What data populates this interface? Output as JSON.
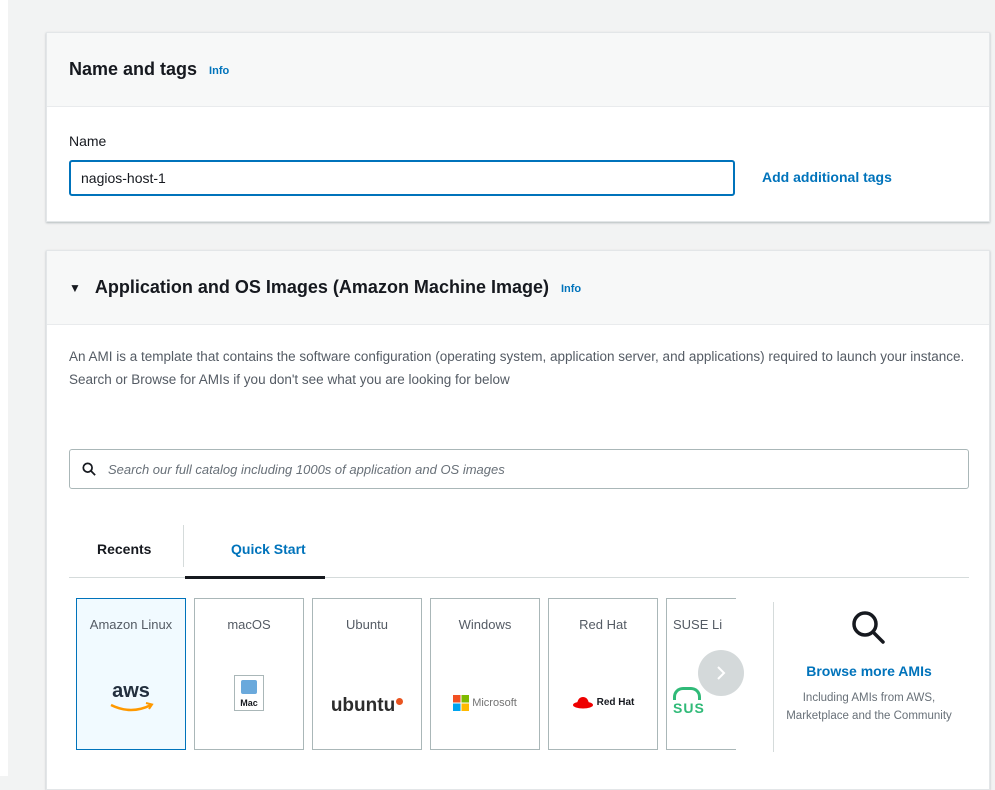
{
  "name_tags": {
    "title": "Name and tags",
    "info": "Info",
    "name_label": "Name",
    "name_value": "nagios-host-1",
    "add_tags": "Add additional tags"
  },
  "ami": {
    "title": "Application and OS Images (Amazon Machine Image)",
    "info": "Info",
    "description": "An AMI is a template that contains the software configuration (operating system, application server, and applications) required to launch your instance. Search or Browse for AMIs if you don't see what you are looking for below",
    "search_placeholder": "Search our full catalog including 1000s of application and OS images",
    "tabs": [
      "Recents",
      "Quick Start"
    ],
    "cards": [
      {
        "name": "Amazon Linux",
        "logo": "aws"
      },
      {
        "name": "macOS",
        "logo": "Mac"
      },
      {
        "name": "Ubuntu",
        "logo": "ubuntu"
      },
      {
        "name": "Windows",
        "logo": "Microsoft"
      },
      {
        "name": "Red Hat",
        "logo": "Red Hat"
      },
      {
        "name": "SUSE Li",
        "logo": "SUS"
      }
    ],
    "browse_more": "Browse more AMIs",
    "browse_sub": "Including AMIs from AWS, Marketplace and the Community"
  },
  "colors": {
    "accent": "#0073bb",
    "text": "#16191f",
    "muted": "#545b64",
    "selected_bg": "#f1faff"
  }
}
